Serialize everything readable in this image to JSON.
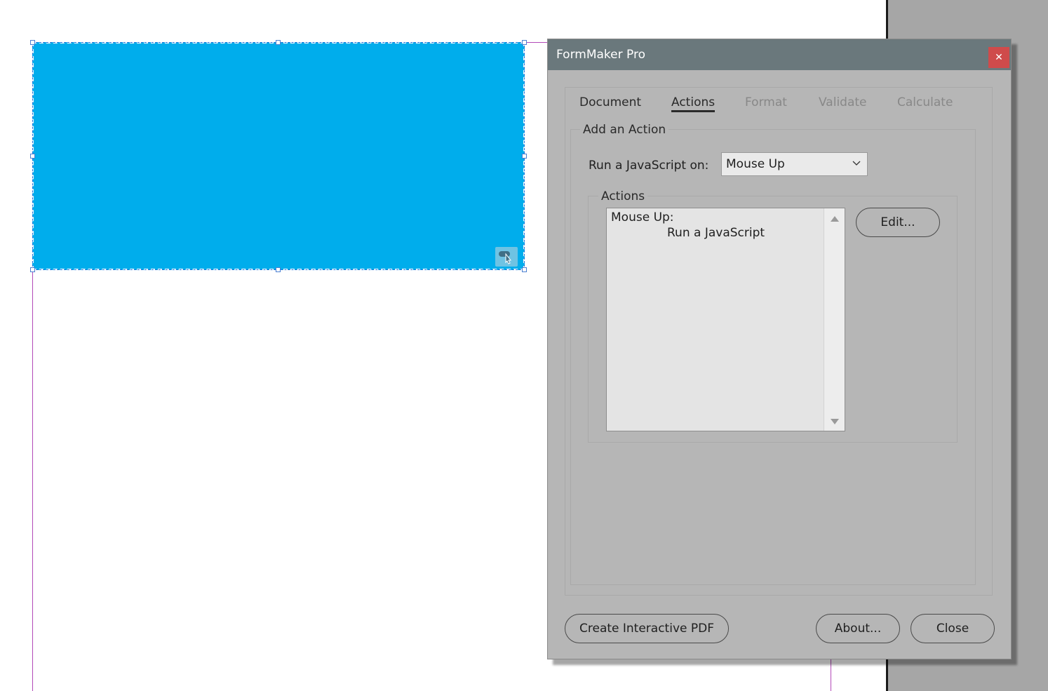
{
  "dialog": {
    "title": "FormMaker Pro",
    "close_icon": "close-icon",
    "tabs": [
      {
        "label": "Document",
        "state": "enabled"
      },
      {
        "label": "Actions",
        "state": "active"
      },
      {
        "label": "Format",
        "state": "disabled"
      },
      {
        "label": "Validate",
        "state": "disabled"
      },
      {
        "label": "Calculate",
        "state": "disabled"
      }
    ],
    "add_action": {
      "legend": "Add an Action",
      "trigger_label": "Run a JavaScript on:",
      "trigger_value": "Mouse Up"
    },
    "actions": {
      "legend": "Actions",
      "list": [
        {
          "event": "Mouse Up:",
          "action": "Run a JavaScript"
        }
      ],
      "edit_label": "Edit..."
    },
    "footer": {
      "create_label": "Create Interactive PDF",
      "about_label": "About...",
      "close_label": "Close"
    }
  },
  "canvas": {
    "field_color": "#00adec",
    "field_badge_icon": "hand-pointer-icon"
  }
}
